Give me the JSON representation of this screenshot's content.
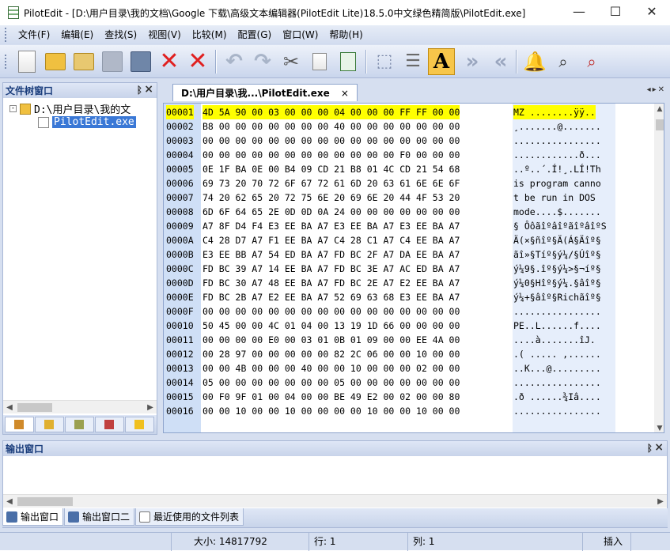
{
  "window": {
    "title": "PilotEdit - [D:\\用户目录\\我的文档\\Google 下载\\高级文本编辑器(PilotEdit Lite)18.5.0中文绿色精简版\\PilotEdit.exe]",
    "minimize": "—",
    "maximize": "☐",
    "close": "✕"
  },
  "menu": {
    "items": [
      "文件(F)",
      "编辑(E)",
      "查找(S)",
      "视图(V)",
      "比较(M)",
      "配置(G)",
      "窗口(W)",
      "帮助(H)"
    ]
  },
  "toolbar": {
    "icons": [
      "new-file-icon",
      "open-folder-icon",
      "open-folder-download-icon",
      "save-icon",
      "save-as-icon",
      "close-file-icon",
      "close-all-icon",
      "undo-icon",
      "redo-icon",
      "cut-icon",
      "copy-icon",
      "paste-icon",
      "select-icon",
      "column-mode-icon",
      "font-icon",
      "indent-icon",
      "unindent-icon",
      "bell-icon",
      "find-icon",
      "find-replace-icon"
    ],
    "font_button": "A"
  },
  "file_tree": {
    "title": "文件树窗口",
    "root": "D:\\用户目录\\我的文",
    "file": "PilotEdit.exe",
    "expander": "-"
  },
  "doc_tab": {
    "label": "D:\\用户目录\\我...\\PilotEdit.exe",
    "close": "×"
  },
  "hex": {
    "rows": [
      {
        "addr": "00001",
        "hex": "4D 5A 90 00 03 00 00 00 04 00 00 00 FF FF 00 00",
        "ascii": "MZ ........ÿÿ..",
        "highlight": true
      },
      {
        "addr": "00002",
        "hex": "B8 00 00 00 00 00 00 00 40 00 00 00 00 00 00 00",
        "ascii": "¸.......@......."
      },
      {
        "addr": "00003",
        "hex": "00 00 00 00 00 00 00 00 00 00 00 00 00 00 00 00",
        "ascii": "................"
      },
      {
        "addr": "00004",
        "hex": "00 00 00 00 00 00 00 00 00 00 00 00 F0 00 00 00",
        "ascii": "............ð..."
      },
      {
        "addr": "00005",
        "hex": "0E 1F BA 0E 00 B4 09 CD 21 B8 01 4C CD 21 54 68",
        "ascii": "..º..´.Í!¸.LÍ!Th"
      },
      {
        "addr": "00006",
        "hex": "69 73 20 70 72 6F 67 72 61 6D 20 63 61 6E 6E 6F",
        "ascii": "is program canno"
      },
      {
        "addr": "00007",
        "hex": "74 20 62 65 20 72 75 6E 20 69 6E 20 44 4F 53 20",
        "ascii": "t be run in DOS "
      },
      {
        "addr": "00008",
        "hex": "6D 6F 64 65 2E 0D 0D 0A 24 00 00 00 00 00 00 00",
        "ascii": "mode....$......."
      },
      {
        "addr": "00009",
        "hex": "A7 8F D4 F4 E3 EE BA A7 E3 EE BA A7 E3 EE BA A7",
        "ascii": "§ ÔôãîºâîºãîºâîºS"
      },
      {
        "addr": "0000A",
        "hex": "C4 28 D7 A7 F1 EE BA A7 C4 28 C1 A7 C4 EE BA A7",
        "ascii": "Ä(×§ñîº§Ä(Á§Äîº§"
      },
      {
        "addr": "0000B",
        "hex": "E3 EE BB A7 54 ED BA A7 FD BC 2F A7 DA EE BA A7",
        "ascii": "ãî»§Tíº§ý¼/§Úîº§"
      },
      {
        "addr": "0000C",
        "hex": "FD BC 39 A7 14 EE BA A7 FD BC 3E A7 AC ED BA A7",
        "ascii": "ý¼9§.îº§ý¼>§¬íº§"
      },
      {
        "addr": "0000D",
        "hex": "FD BC 30 A7 48 EE BA A7 FD BC 2E A7 E2 EE BA A7",
        "ascii": "ý¼0§Hîº§ý¼.§âîº§"
      },
      {
        "addr": "0000E",
        "hex": "FD BC 2B A7 E2 EE BA A7 52 69 63 68 E3 EE BA A7",
        "ascii": "ý¼+§âîº§Richãîº§"
      },
      {
        "addr": "0000F",
        "hex": "00 00 00 00 00 00 00 00 00 00 00 00 00 00 00 00",
        "ascii": "................"
      },
      {
        "addr": "00010",
        "hex": "50 45 00 00 4C 01 04 00 13 19 1D 66 00 00 00 00",
        "ascii": "PE..L......f...."
      },
      {
        "addr": "00011",
        "hex": "00 00 00 00 E0 00 03 01 0B 01 09 00 00 EE 4A 00",
        "ascii": "....à.......îJ."
      },
      {
        "addr": "00012",
        "hex": "00 28 97 00 00 00 00 00 82 2C 06 00 00 10 00 00",
        "ascii": ".( ..... ,......"
      },
      {
        "addr": "00013",
        "hex": "00 00 4B 00 00 00 40 00 00 10 00 00 00 02 00 00",
        "ascii": "..K...@........."
      },
      {
        "addr": "00014",
        "hex": "05 00 00 00 00 00 00 00 05 00 00 00 00 00 00 00",
        "ascii": "................"
      },
      {
        "addr": "00015",
        "hex": "00 F0 9F 01 00 04 00 00 BE 49 E2 00 02 00 00 80",
        "ascii": ".ð ......¾Iâ...."
      },
      {
        "addr": "00016",
        "hex": "00 00 10 00 00 10 00 00 00 00 10 00 00 10 00 00",
        "ascii": "................"
      }
    ]
  },
  "output": {
    "title": "输出窗口",
    "tabs": [
      "输出窗口",
      "输出窗口二",
      "最近使用的文件列表"
    ]
  },
  "status": {
    "size": "大小: 14817792",
    "line": "行: 1",
    "col": "列: 1",
    "mode": "插入"
  },
  "panel_controls": {
    "pin": "ᛒ",
    "close": "×"
  }
}
